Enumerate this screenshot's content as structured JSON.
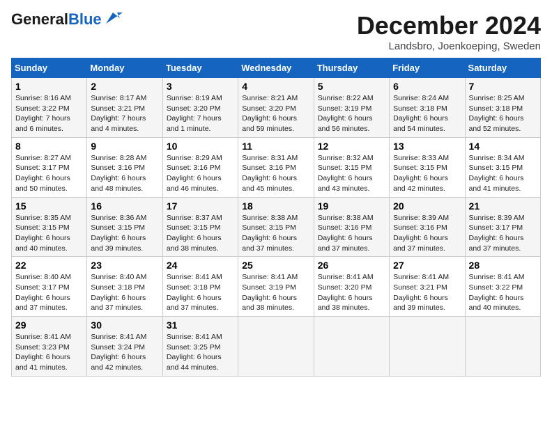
{
  "header": {
    "logo_general": "General",
    "logo_blue": "Blue",
    "month": "December 2024",
    "location": "Landsbro, Joenkoeping, Sweden"
  },
  "columns": [
    "Sunday",
    "Monday",
    "Tuesday",
    "Wednesday",
    "Thursday",
    "Friday",
    "Saturday"
  ],
  "weeks": [
    [
      {
        "day": "1",
        "sunrise": "Sunrise: 8:16 AM",
        "sunset": "Sunset: 3:22 PM",
        "daylight": "Daylight: 7 hours and 6 minutes."
      },
      {
        "day": "2",
        "sunrise": "Sunrise: 8:17 AM",
        "sunset": "Sunset: 3:21 PM",
        "daylight": "Daylight: 7 hours and 4 minutes."
      },
      {
        "day": "3",
        "sunrise": "Sunrise: 8:19 AM",
        "sunset": "Sunset: 3:20 PM",
        "daylight": "Daylight: 7 hours and 1 minute."
      },
      {
        "day": "4",
        "sunrise": "Sunrise: 8:21 AM",
        "sunset": "Sunset: 3:20 PM",
        "daylight": "Daylight: 6 hours and 59 minutes."
      },
      {
        "day": "5",
        "sunrise": "Sunrise: 8:22 AM",
        "sunset": "Sunset: 3:19 PM",
        "daylight": "Daylight: 6 hours and 56 minutes."
      },
      {
        "day": "6",
        "sunrise": "Sunrise: 8:24 AM",
        "sunset": "Sunset: 3:18 PM",
        "daylight": "Daylight: 6 hours and 54 minutes."
      },
      {
        "day": "7",
        "sunrise": "Sunrise: 8:25 AM",
        "sunset": "Sunset: 3:18 PM",
        "daylight": "Daylight: 6 hours and 52 minutes."
      }
    ],
    [
      {
        "day": "8",
        "sunrise": "Sunrise: 8:27 AM",
        "sunset": "Sunset: 3:17 PM",
        "daylight": "Daylight: 6 hours and 50 minutes."
      },
      {
        "day": "9",
        "sunrise": "Sunrise: 8:28 AM",
        "sunset": "Sunset: 3:16 PM",
        "daylight": "Daylight: 6 hours and 48 minutes."
      },
      {
        "day": "10",
        "sunrise": "Sunrise: 8:29 AM",
        "sunset": "Sunset: 3:16 PM",
        "daylight": "Daylight: 6 hours and 46 minutes."
      },
      {
        "day": "11",
        "sunrise": "Sunrise: 8:31 AM",
        "sunset": "Sunset: 3:16 PM",
        "daylight": "Daylight: 6 hours and 45 minutes."
      },
      {
        "day": "12",
        "sunrise": "Sunrise: 8:32 AM",
        "sunset": "Sunset: 3:15 PM",
        "daylight": "Daylight: 6 hours and 43 minutes."
      },
      {
        "day": "13",
        "sunrise": "Sunrise: 8:33 AM",
        "sunset": "Sunset: 3:15 PM",
        "daylight": "Daylight: 6 hours and 42 minutes."
      },
      {
        "day": "14",
        "sunrise": "Sunrise: 8:34 AM",
        "sunset": "Sunset: 3:15 PM",
        "daylight": "Daylight: 6 hours and 41 minutes."
      }
    ],
    [
      {
        "day": "15",
        "sunrise": "Sunrise: 8:35 AM",
        "sunset": "Sunset: 3:15 PM",
        "daylight": "Daylight: 6 hours and 40 minutes."
      },
      {
        "day": "16",
        "sunrise": "Sunrise: 8:36 AM",
        "sunset": "Sunset: 3:15 PM",
        "daylight": "Daylight: 6 hours and 39 minutes."
      },
      {
        "day": "17",
        "sunrise": "Sunrise: 8:37 AM",
        "sunset": "Sunset: 3:15 PM",
        "daylight": "Daylight: 6 hours and 38 minutes."
      },
      {
        "day": "18",
        "sunrise": "Sunrise: 8:38 AM",
        "sunset": "Sunset: 3:15 PM",
        "daylight": "Daylight: 6 hours and 37 minutes."
      },
      {
        "day": "19",
        "sunrise": "Sunrise: 8:38 AM",
        "sunset": "Sunset: 3:16 PM",
        "daylight": "Daylight: 6 hours and 37 minutes."
      },
      {
        "day": "20",
        "sunrise": "Sunrise: 8:39 AM",
        "sunset": "Sunset: 3:16 PM",
        "daylight": "Daylight: 6 hours and 37 minutes."
      },
      {
        "day": "21",
        "sunrise": "Sunrise: 8:39 AM",
        "sunset": "Sunset: 3:17 PM",
        "daylight": "Daylight: 6 hours and 37 minutes."
      }
    ],
    [
      {
        "day": "22",
        "sunrise": "Sunrise: 8:40 AM",
        "sunset": "Sunset: 3:17 PM",
        "daylight": "Daylight: 6 hours and 37 minutes."
      },
      {
        "day": "23",
        "sunrise": "Sunrise: 8:40 AM",
        "sunset": "Sunset: 3:18 PM",
        "daylight": "Daylight: 6 hours and 37 minutes."
      },
      {
        "day": "24",
        "sunrise": "Sunrise: 8:41 AM",
        "sunset": "Sunset: 3:18 PM",
        "daylight": "Daylight: 6 hours and 37 minutes."
      },
      {
        "day": "25",
        "sunrise": "Sunrise: 8:41 AM",
        "sunset": "Sunset: 3:19 PM",
        "daylight": "Daylight: 6 hours and 38 minutes."
      },
      {
        "day": "26",
        "sunrise": "Sunrise: 8:41 AM",
        "sunset": "Sunset: 3:20 PM",
        "daylight": "Daylight: 6 hours and 38 minutes."
      },
      {
        "day": "27",
        "sunrise": "Sunrise: 8:41 AM",
        "sunset": "Sunset: 3:21 PM",
        "daylight": "Daylight: 6 hours and 39 minutes."
      },
      {
        "day": "28",
        "sunrise": "Sunrise: 8:41 AM",
        "sunset": "Sunset: 3:22 PM",
        "daylight": "Daylight: 6 hours and 40 minutes."
      }
    ],
    [
      {
        "day": "29",
        "sunrise": "Sunrise: 8:41 AM",
        "sunset": "Sunset: 3:23 PM",
        "daylight": "Daylight: 6 hours and 41 minutes."
      },
      {
        "day": "30",
        "sunrise": "Sunrise: 8:41 AM",
        "sunset": "Sunset: 3:24 PM",
        "daylight": "Daylight: 6 hours and 42 minutes."
      },
      {
        "day": "31",
        "sunrise": "Sunrise: 8:41 AM",
        "sunset": "Sunset: 3:25 PM",
        "daylight": "Daylight: 6 hours and 44 minutes."
      },
      null,
      null,
      null,
      null
    ]
  ]
}
